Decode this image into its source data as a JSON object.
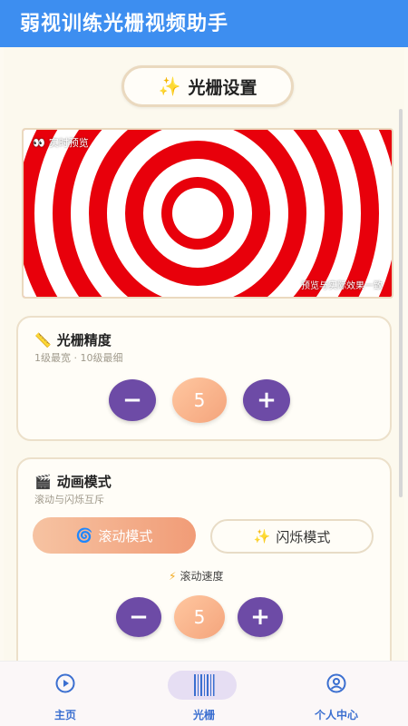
{
  "app": {
    "title": "弱视训练光栅视频助手"
  },
  "header": {
    "icon": "sparkles-icon",
    "title": "光栅设置"
  },
  "preview": {
    "live_label": "实时预览",
    "live_icon": "eyes-icon",
    "note": "预览与实际效果一致",
    "colors": {
      "ring": "#e8000b",
      "background": "#ffffff"
    }
  },
  "precision_card": {
    "icon": "ruler-icon",
    "title": "光栅精度",
    "subtitle": "1级最宽 · 10级最细",
    "value": "5",
    "minus_label": "−",
    "plus_label": "+"
  },
  "animation_card": {
    "icon": "clapper-icon",
    "title": "动画模式",
    "subtitle": "滚动与闪烁互斥",
    "modes": [
      {
        "icon": "spiral-icon",
        "glyph": "🌀",
        "label": "滚动模式",
        "selected": true
      },
      {
        "icon": "sparkles-icon",
        "glyph": "✨",
        "label": "闪烁模式",
        "selected": false
      }
    ],
    "speed_icon": "lightning-icon",
    "speed_label": "滚动速度",
    "speed_value": "5",
    "minus_label": "−",
    "plus_label": "+"
  },
  "tabs": [
    {
      "icon": "play-circle-icon",
      "label": "主页",
      "active": false
    },
    {
      "icon": "barcode-icon",
      "label": "光栅",
      "active": true
    },
    {
      "icon": "user-circle-icon",
      "label": "个人中心",
      "active": false
    }
  ],
  "colors": {
    "appbar": "#3d8ef0",
    "accent": "#6d4ba6",
    "tab_text": "#3b6fd0"
  }
}
